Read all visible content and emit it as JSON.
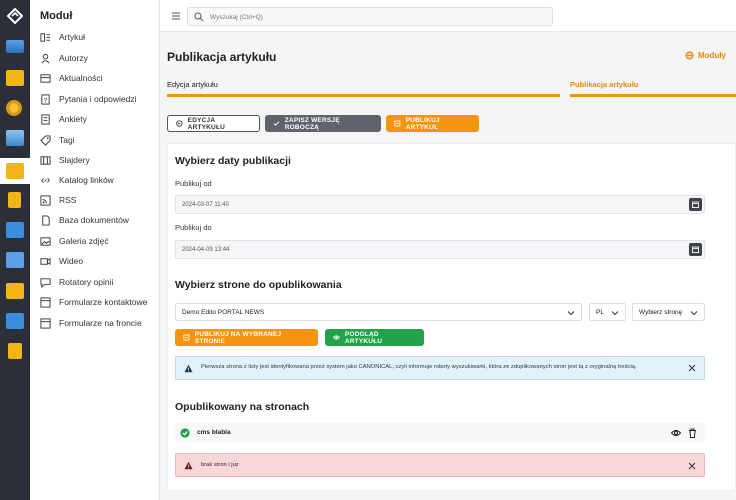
{
  "sidebar": {
    "title": "Moduł",
    "items": [
      {
        "label": "Artykuł",
        "icon": "article-icon"
      },
      {
        "label": "Autorzy",
        "icon": "user-icon"
      },
      {
        "label": "Aktualności",
        "icon": "news-icon"
      },
      {
        "label": "Pytania i odpowiedzi",
        "icon": "question-icon"
      },
      {
        "label": "Ankiety",
        "icon": "survey-icon"
      },
      {
        "label": "Tagi",
        "icon": "tag-icon"
      },
      {
        "label": "Slajdery",
        "icon": "slider-icon"
      },
      {
        "label": "Katalog linków",
        "icon": "link-icon"
      },
      {
        "label": "RSS",
        "icon": "rss-icon"
      },
      {
        "label": "Baza dokumentów",
        "icon": "document-icon"
      },
      {
        "label": "Galeria zdjęć",
        "icon": "gallery-icon"
      },
      {
        "label": "Wideo",
        "icon": "video-icon"
      },
      {
        "label": "Rotatory opinii",
        "icon": "opinion-icon"
      },
      {
        "label": "Formularze kontaktowe",
        "icon": "form-icon"
      },
      {
        "label": "Formularze na froncie",
        "icon": "form-front-icon"
      }
    ]
  },
  "search": {
    "placeholder": "Wyszukaj (Ctrl+Q)"
  },
  "header": {
    "title": "Publikacja artykułu",
    "modules_label": "Moduły"
  },
  "tabs": [
    {
      "label": "Edycja artykułu",
      "active": false
    },
    {
      "label": "Publikacja artykułu",
      "active": true
    }
  ],
  "actions": {
    "edit": "EDYCJA ARTYKUŁU",
    "save_draft": "ZAPISZ WERSJĘ ROBOCZĄ",
    "publish": "PUBLIKUJ ARTYKUŁ"
  },
  "dates": {
    "heading": "Wybierz daty publikacji",
    "from_label": "Publikuj od",
    "from_value": "2024-03-07 11:40",
    "to_label": "Publikuj do",
    "to_value": "2024-04-09 13:44"
  },
  "page_select": {
    "heading": "Wybierz strone do opublikowania",
    "portal_value": "Demo Edito PORTAL NEWS",
    "lang_value": "PL",
    "page_placeholder": "Wybierz stronę",
    "publish_button": "PUBLIKUJ NA WYBRANEJ STRONIE",
    "preview_button": "PODGLĄD ARTYKUŁU"
  },
  "info_message": "Pierwsza strona z listy jest identyfikowana przez system jako CANONICAL, czyli informuje roboty wyszukiwarki, która ze zduplikowanych stron jest tą z oryginalną treścią.",
  "published": {
    "heading": "Opublikowany na stronach",
    "items": [
      {
        "name": "cms blabla"
      }
    ]
  },
  "error_message": "brak stron i juz",
  "colors": {
    "accent": "#f0930e",
    "success": "#1fa44a",
    "dark": "#3e4249",
    "rail": "#2b2f38"
  }
}
